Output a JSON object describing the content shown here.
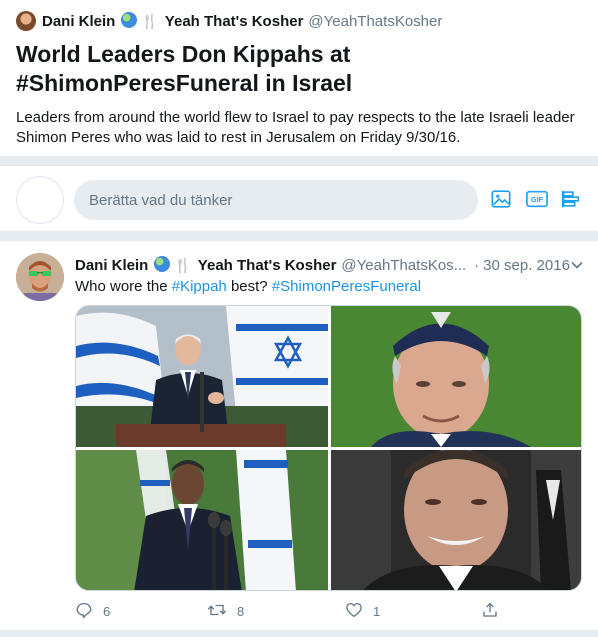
{
  "moment": {
    "author_name": "Dani Klein",
    "author_suffix": "Yeah That's Kosher",
    "author_handle": "@YeahThatsKosher",
    "title": "World Leaders Don Kippahs at #ShimonPeresFuneral in Israel",
    "description": "Leaders from around the world flew to Israel to pay respects to the late Israeli leader Shimon Peres who was laid to rest in Jerusalem on Friday 9/30/16."
  },
  "compose": {
    "placeholder": "Berätta vad du tänker",
    "icons": [
      "image-icon",
      "gif-icon",
      "poll-icon"
    ]
  },
  "tweet": {
    "author_name": "Dani Klein",
    "author_suffix": "Yeah That's Kosher",
    "author_handle": "@YeahThatsKos...",
    "date": "30 sep. 2016",
    "text_prefix": "Who wore the ",
    "hashtag1": "#Kippah",
    "text_middle": " best? ",
    "hashtag2": "#ShimonPeresFuneral",
    "photos": [
      "leader-speaking-at-podium-photo",
      "leader-wearing-kippah-photo",
      "leader-at-microphone-photo",
      "leader-smiling-photo"
    ],
    "actions": {
      "replies": "6",
      "retweets": "8",
      "likes": "1"
    }
  },
  "colors": {
    "link": "#1b95e0",
    "secondary_text": "#657786",
    "separator": "#e6ecf0"
  }
}
